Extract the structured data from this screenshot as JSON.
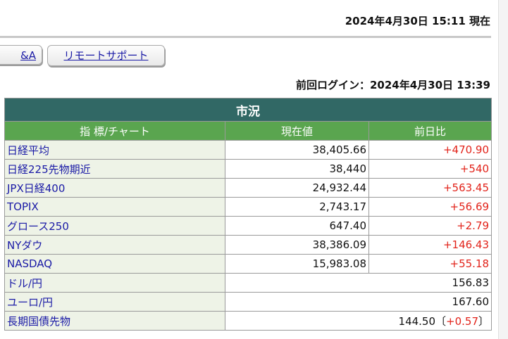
{
  "header": {
    "datetime": "2024年4月30日 15:11 現在",
    "last_login": "前回ログイン：2024年4月30日 13:39"
  },
  "tabs": [
    {
      "label": "&A"
    },
    {
      "label": "リモートサポート"
    }
  ],
  "market": {
    "title": "市況",
    "columns": [
      "指 標/チャート",
      "現在値",
      "前日比"
    ],
    "rows": [
      {
        "name": "日経平均",
        "value": "38,405.66",
        "change": "+470.90"
      },
      {
        "name": "日経225先物期近",
        "value": "38,440",
        "change": "+540"
      },
      {
        "name": "JPX日経400",
        "value": "24,932.44",
        "change": "+563.45"
      },
      {
        "name": "TOPIX",
        "value": "2,743.17",
        "change": "+56.69"
      },
      {
        "name": "グロース250",
        "value": "647.40",
        "change": "+2.79"
      },
      {
        "name": "NYダウ",
        "value": "38,386.09",
        "change": "+146.43"
      },
      {
        "name": "NASDAQ",
        "value": "15,983.08",
        "change": "+55.18"
      }
    ],
    "fx_rows": [
      {
        "name": "ドル/円",
        "value": "156.83"
      },
      {
        "name": "ユーロ/円",
        "value": "167.60"
      }
    ],
    "bond_row": {
      "name": "長期国債先物",
      "value": "144.50",
      "open_paren": "〔",
      "change": "+0.57",
      "close_paren": "〕"
    }
  }
}
